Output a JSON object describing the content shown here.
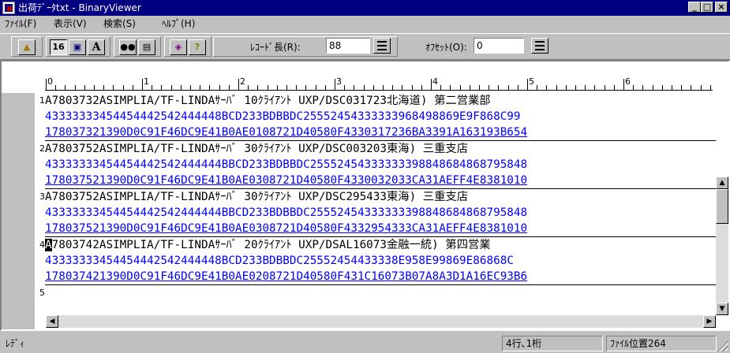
{
  "window": {
    "title": "出荷ﾃﾞｰﾀtxt - BinaryViewer",
    "minimize": "_",
    "maximize": "□",
    "close": "×"
  },
  "menu": [
    {
      "label": "ﾌｧｲﾙ(F)"
    },
    {
      "label": "表示(V)"
    },
    {
      "label": "検索(S)"
    },
    {
      "label": "ﾍﾙﾌﾟ(H)"
    }
  ],
  "toolbar": {
    "buttons": [
      {
        "icon": "folder-open-icon",
        "glyph": "📂"
      },
      {
        "icon": "hex-16-icon",
        "glyph": "16"
      },
      {
        "icon": "display-icon",
        "glyph": "▣"
      },
      {
        "icon": "font-size-icon",
        "glyph": "A"
      },
      {
        "icon": "binoculars-icon",
        "glyph": "👀"
      },
      {
        "icon": "page-icon",
        "glyph": "▤"
      },
      {
        "icon": "book-icon",
        "glyph": "◈"
      },
      {
        "icon": "help-icon",
        "glyph": "?"
      }
    ],
    "record_length_label": "ﾚｺｰﾄﾞ長(R):",
    "record_length_value": "88",
    "offset_label": "ｵﾌｾｯﾄ(O):",
    "offset_value": "0"
  },
  "ruler": {
    "labels": [
      "0",
      "1",
      "2",
      "3",
      "4",
      "5",
      "6"
    ]
  },
  "records": [
    {
      "num": "1",
      "text": "A7803732ASIMPLIA/TF-LINDAｻｰﾊﾞ 10ｸﾗｲｱﾝﾄ UXP/DSC031723北海道) 第二営業部",
      "hex_hi": "43333333454454442542444448BCD233BDBBDC25552454333333968498869E9F868C99",
      "hex_lo": "178037321390D0C91F46DC9E41B0AE0108721D40580F4330317236BA3391A163193B654"
    },
    {
      "num": "2",
      "text": "A7803752ASIMPLIA/TF-LINDAｻｰﾊﾞ 30ｸﾗｲｱﾝﾄ UXP/DSC003203東海) 三重支店",
      "hex_hi": "43333333454454442542444444BBCD233BDBBDC25552454333333398848684868795848",
      "hex_lo": "178037521390D0C91F46DC9E41B0AE0308721D40580F4330032033CA31AEFF4E8381010"
    },
    {
      "num": "3",
      "text": "A7803752ASIMPLIA/TF-LINDAｻｰﾊﾞ 30ｸﾗｲｱﾝﾄ UXP/DSC295433東海) 三重支店",
      "hex_hi": "43333333454454442542444444BBCD233BDBBDC25552454333333398848684868795848",
      "hex_lo": "178037521390D0C91F46DC9E41B0AE0308721D40580F4332954333CA31AEFF4E8381010"
    },
    {
      "num": "4",
      "cursor_char": "A",
      "text": "7803742ASIMPLIA/TF-LINDAｻｰﾊﾞ 20ｸﾗｲｱﾝﾄ UXP/DSAL16073金融一統) 第四営業",
      "hex_hi": "43333333454454442542444448BCD233BDBBDC25552454433338E958E99869E86868C",
      "hex_lo": "178037421390D0C91F46DC9E41B0AE0208721D40580F431C16073B07A8A3D1A16EC93B6"
    },
    {
      "num": "5"
    }
  ],
  "status": {
    "ready": "ﾚﾃﾞｨ",
    "position": "4行､1桁",
    "file_pos": "ﾌｧｲﾙ位置264"
  }
}
